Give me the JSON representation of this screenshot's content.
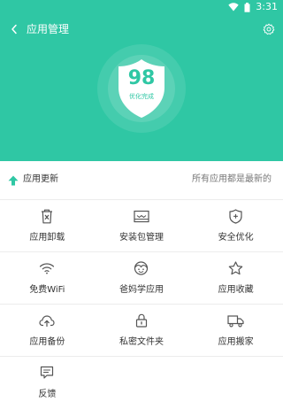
{
  "status_bar": {
    "time": "3:31"
  },
  "header": {
    "title": "应用管理"
  },
  "score": {
    "value": "98",
    "caption": "优化完成"
  },
  "update": {
    "label": "应用更新",
    "status": "所有应用都是最新的"
  },
  "tiles": [
    {
      "label": "应用卸载",
      "icon": "trash-icon"
    },
    {
      "label": "安装包管理",
      "icon": "package-icon"
    },
    {
      "label": "安全优化",
      "icon": "shield-plus-icon"
    },
    {
      "label": "免费WiFi",
      "icon": "wifi-icon"
    },
    {
      "label": "爸妈学应用",
      "icon": "parents-icon"
    },
    {
      "label": "应用收藏",
      "icon": "star-icon"
    },
    {
      "label": "应用备份",
      "icon": "cloud-upload-icon"
    },
    {
      "label": "私密文件夹",
      "icon": "lock-icon"
    },
    {
      "label": "应用搬家",
      "icon": "truck-icon"
    },
    {
      "label": "反馈",
      "icon": "feedback-icon"
    }
  ],
  "colors": {
    "accent": "#2fc7a4",
    "icon_stroke": "#555555"
  }
}
